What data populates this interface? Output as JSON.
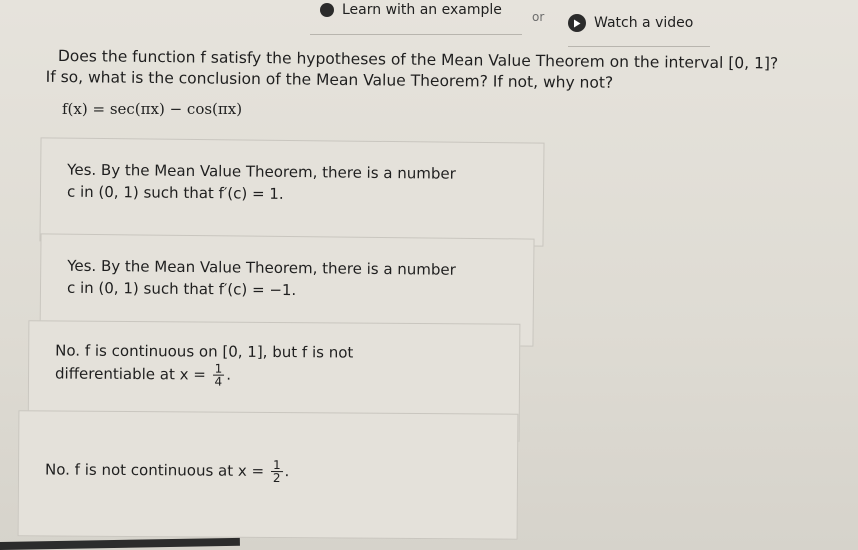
{
  "header": {
    "learn_label": "Learn with an example",
    "or_label": "or",
    "video_label": "Watch a video"
  },
  "question": {
    "line1": "Does the function f satisfy the hypotheses of the Mean Value Theorem on the interval [0, 1]?",
    "line2": "If so, what is the conclusion of the Mean Value Theorem? If not, why not?",
    "formula": "f(x) = sec(πx) − cos(πx)"
  },
  "options": [
    {
      "line1": "Yes. By the Mean Value Theorem, there is a number",
      "line2": "c in (0, 1) such that f′(c) = 1."
    },
    {
      "line1": "Yes. By the Mean Value Theorem, there is a number",
      "line2": "c in (0, 1) such that f′(c) = −1."
    },
    {
      "line1": "No. f is continuous on [0, 1], but f is not",
      "line2_prefix": "differentiable at x =",
      "frac_num": "1",
      "frac_den": "4",
      "line2_suffix": "."
    },
    {
      "prefix": "No. f is not continuous at x =",
      "frac_num": "1",
      "frac_den": "2",
      "suffix": "."
    }
  ]
}
